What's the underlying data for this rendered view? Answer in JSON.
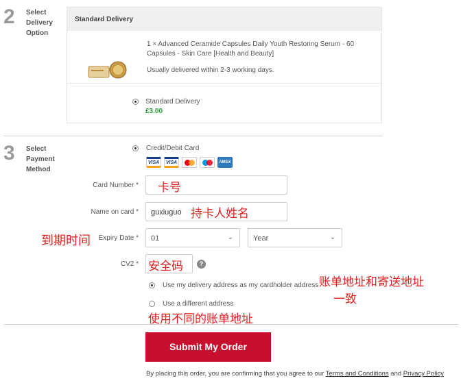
{
  "steps": [
    {
      "number": "2",
      "label": "Select\nDelivery\nOption"
    },
    {
      "number": "3",
      "label": "Select\nPayment\nMethod"
    }
  ],
  "delivery": {
    "header": "Standard Delivery",
    "product_line1": "1 × Advanced Ceramide Capsules Daily Youth Restoring Serum - 60",
    "product_line2": "Capsules - Skin Care [Health and Beauty]",
    "eta": "Usually delivered within 2-3 working days.",
    "option_label": "Standard Delivery",
    "option_price": "£3.00"
  },
  "payment": {
    "method_label": "Credit/Debit Card",
    "card_logos": [
      {
        "icon": "visa-icon",
        "text": "VISA"
      },
      {
        "icon": "visa-electron-icon",
        "text": "VISA"
      },
      {
        "icon": "mastercard-icon",
        "text": ""
      },
      {
        "icon": "maestro-icon",
        "text": ""
      },
      {
        "icon": "amex-icon",
        "text": "AMEX"
      }
    ],
    "card_number_label": "Card Number",
    "name_label": "Name on card",
    "name_value": "guxiuguo",
    "expiry_label": "Expiry Date",
    "expiry_month": "01",
    "expiry_year": "Year",
    "cv2_label": "CV2",
    "help_icon": "?",
    "use_delivery_address": "Use my delivery address as my cardholder address",
    "use_different_address": "Use a different address"
  },
  "annotations": {
    "card_number": "卡号",
    "name": "持卡人姓名",
    "expiry": "到期时间",
    "cv2": "安全码",
    "billing_same_1": "账单地址和寄送地址",
    "billing_same_2": "一致",
    "billing_different": "使用不同的账单地址"
  },
  "submit_label": "Submit My Order",
  "footer": {
    "prefix": "By placing this order, you are confirming that you agree to our ",
    "terms": "Terms and Conditions",
    "and": " and ",
    "privacy": "Privacy Policy"
  },
  "colors": {
    "submit": "#c8102e",
    "price": "#2a9c37",
    "annotation": "#e02020"
  }
}
